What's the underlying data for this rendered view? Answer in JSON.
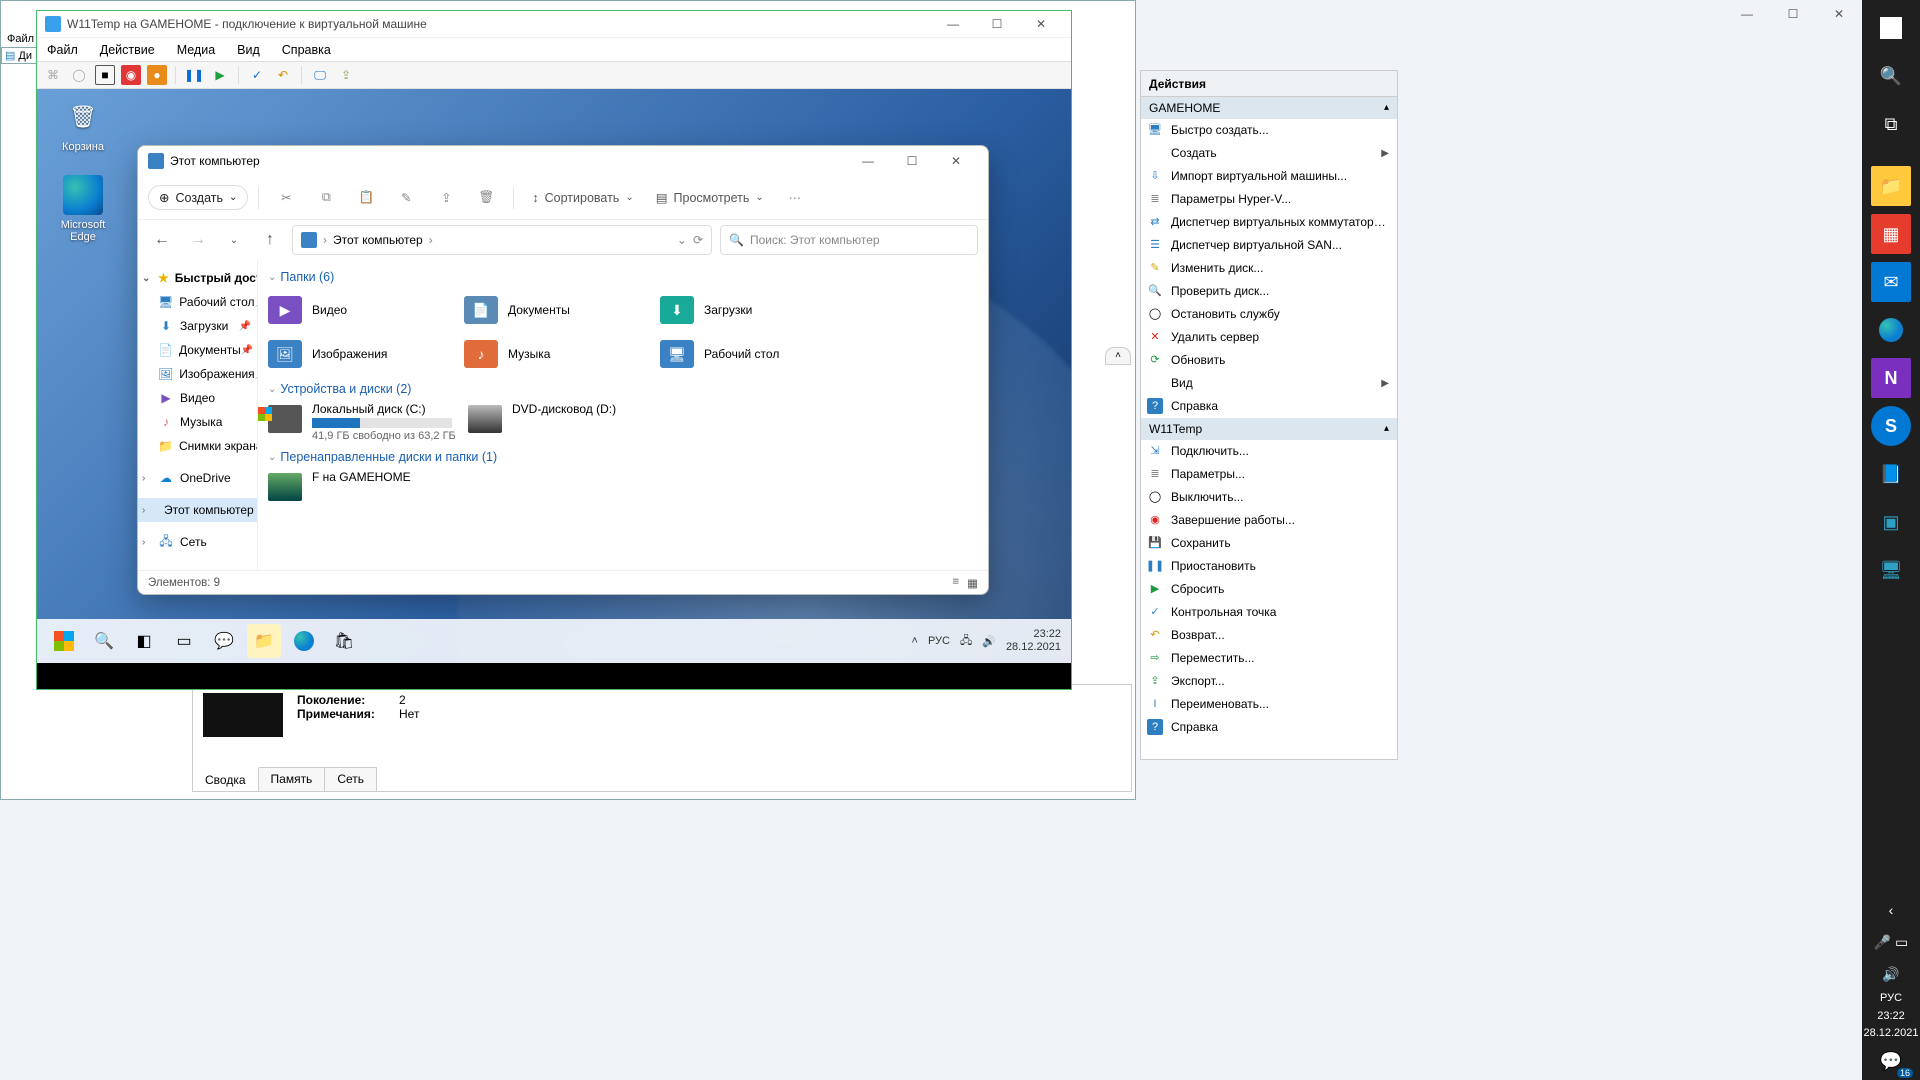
{
  "host": {
    "taskbar_icons": [
      "win",
      "search",
      "tasks",
      "explorer",
      "store",
      "mail",
      "edge",
      "onenote",
      "skype",
      "book",
      "cube1",
      "cube2"
    ],
    "lang": "РУС",
    "time": "23:22",
    "date": "28.12.2021",
    "notif_count": "16"
  },
  "hvmgr": {
    "left_menu": [
      "Файл",
      "Ди"
    ],
    "actions_title": "Действия",
    "section1": "GAMEHOME",
    "section2": "W11Temp",
    "host_actions": [
      {
        "label": "Быстро создать...",
        "icon": "🖥",
        "color": "#2e7fc1"
      },
      {
        "label": "Создать",
        "icon": "",
        "color": "",
        "arrow": true
      },
      {
        "label": "Импорт виртуальной машины...",
        "icon": "⇩",
        "color": "#2e7fc1"
      },
      {
        "label": "Параметры Hyper-V...",
        "icon": "≣",
        "color": "#888"
      },
      {
        "label": "Диспетчер виртуальных коммутаторо...",
        "icon": "⇄",
        "color": "#2e7fc1"
      },
      {
        "label": "Диспетчер виртуальной SAN...",
        "icon": "☰",
        "color": "#2e7fc1"
      },
      {
        "label": "Изменить диск...",
        "icon": "✎",
        "color": "#d9a400"
      },
      {
        "label": "Проверить диск...",
        "icon": "🔍",
        "color": "#888"
      },
      {
        "label": "Остановить службу",
        "icon": "◯",
        "color": "#000"
      },
      {
        "label": "Удалить сервер",
        "icon": "✕",
        "color": "#d22"
      },
      {
        "label": "Обновить",
        "icon": "⟳",
        "color": "#1a9c3f"
      },
      {
        "label": "Вид",
        "icon": "",
        "color": "",
        "arrow": true
      },
      {
        "label": "Справка",
        "icon": "?",
        "color": "#fff",
        "bg": "#2e7fc1"
      }
    ],
    "vm_actions": [
      {
        "label": "Подключить...",
        "icon": "⇲",
        "color": "#2e7fc1"
      },
      {
        "label": "Параметры...",
        "icon": "≣",
        "color": "#888"
      },
      {
        "label": "Выключить...",
        "icon": "◯",
        "color": "#000"
      },
      {
        "label": "Завершение работы...",
        "icon": "◉",
        "color": "#d22"
      },
      {
        "label": "Сохранить",
        "icon": "💾",
        "color": "#d98f00"
      },
      {
        "label": "Приостановить",
        "icon": "❚❚",
        "color": "#2e7fc1"
      },
      {
        "label": "Сбросить",
        "icon": "▶",
        "color": "#1a9c3f"
      },
      {
        "label": "Контрольная точка",
        "icon": "✓",
        "color": "#2e7fc1"
      },
      {
        "label": "Возврат...",
        "icon": "↶",
        "color": "#d98f00"
      },
      {
        "label": "Переместить...",
        "icon": "⇨",
        "color": "#1a9c3f"
      },
      {
        "label": "Экспорт...",
        "icon": "⇪",
        "color": "#1a9c3f"
      },
      {
        "label": "Переименовать...",
        "icon": "I",
        "color": "#2e7fc1"
      },
      {
        "label": "Справка",
        "icon": "?",
        "color": "#fff",
        "bg": "#2e7fc1"
      }
    ],
    "details": {
      "gen_label": "Поколение:",
      "gen_val": "2",
      "notes_label": "Примечания:",
      "notes_val": "Нет",
      "tabs": [
        "Сводка",
        "Память",
        "Сеть"
      ]
    }
  },
  "vmconnect": {
    "title": "W11Temp на GAMEHOME - подключение к виртуальной машине",
    "menus": [
      "Файл",
      "Действие",
      "Медиа",
      "Вид",
      "Справка"
    ]
  },
  "guest": {
    "desktop_icons": [
      {
        "label": "Корзина",
        "glyph": "🗑"
      },
      {
        "label": "Microsoft Edge",
        "glyph": "e"
      }
    ],
    "lang": "РУС",
    "time": "23:22",
    "date": "28.12.2021"
  },
  "explorer": {
    "title": "Этот компьютер",
    "new_label": "Создать",
    "sort_label": "Сортировать",
    "view_label": "Просмотреть",
    "breadcrumb": "Этот компьютер",
    "search_placeholder": "Поиск: Этот компьютер",
    "sidebar_quick": "Быстрый доступ",
    "sidebar_pinned": [
      {
        "label": "Рабочий стол",
        "icon": "🖥",
        "color": "#2e7fc1"
      },
      {
        "label": "Загрузки",
        "icon": "⬇",
        "color": "#2e7fc1"
      },
      {
        "label": "Документы",
        "icon": "📄",
        "color": "#2e7fc1"
      },
      {
        "label": "Изображения",
        "icon": "🖼",
        "color": "#2e7fc1"
      }
    ],
    "sidebar_recent": [
      {
        "label": "Видео",
        "icon": "▶",
        "color": "#7a4fc1"
      },
      {
        "label": "Музыка",
        "icon": "♪",
        "color": "#d66"
      },
      {
        "label": "Снимки экрана",
        "icon": "📁",
        "color": "#e8b23c"
      }
    ],
    "sidebar_onedrive": "OneDrive",
    "sidebar_thispc": "Этот компьютер",
    "sidebar_network": "Сеть",
    "group_folders": "Папки (6)",
    "folders": [
      {
        "label": "Видео",
        "bg": "#7a4fc1",
        "glyph": "▶"
      },
      {
        "label": "Документы",
        "bg": "#5b8bb5",
        "glyph": "📄"
      },
      {
        "label": "Загрузки",
        "bg": "#18a999",
        "glyph": "⬇"
      },
      {
        "label": "Изображения",
        "bg": "#3b82c4",
        "glyph": "🖼"
      },
      {
        "label": "Музыка",
        "bg": "#e06c3c",
        "glyph": "♪"
      },
      {
        "label": "Рабочий стол",
        "bg": "#3b82c4",
        "glyph": "🖥"
      }
    ],
    "group_drives": "Устройства и диски (2)",
    "drive_c": {
      "label": "Локальный диск (C:)",
      "free": "41,9 ГБ свободно из 63,2 ГБ",
      "fill_pct": 34
    },
    "drive_d": {
      "label": "DVD-дисковод (D:)"
    },
    "group_redirect": "Перенаправленные диски и папки (1)",
    "redirect_label": "F на GAMEHOME",
    "status": "Элементов: 9"
  }
}
